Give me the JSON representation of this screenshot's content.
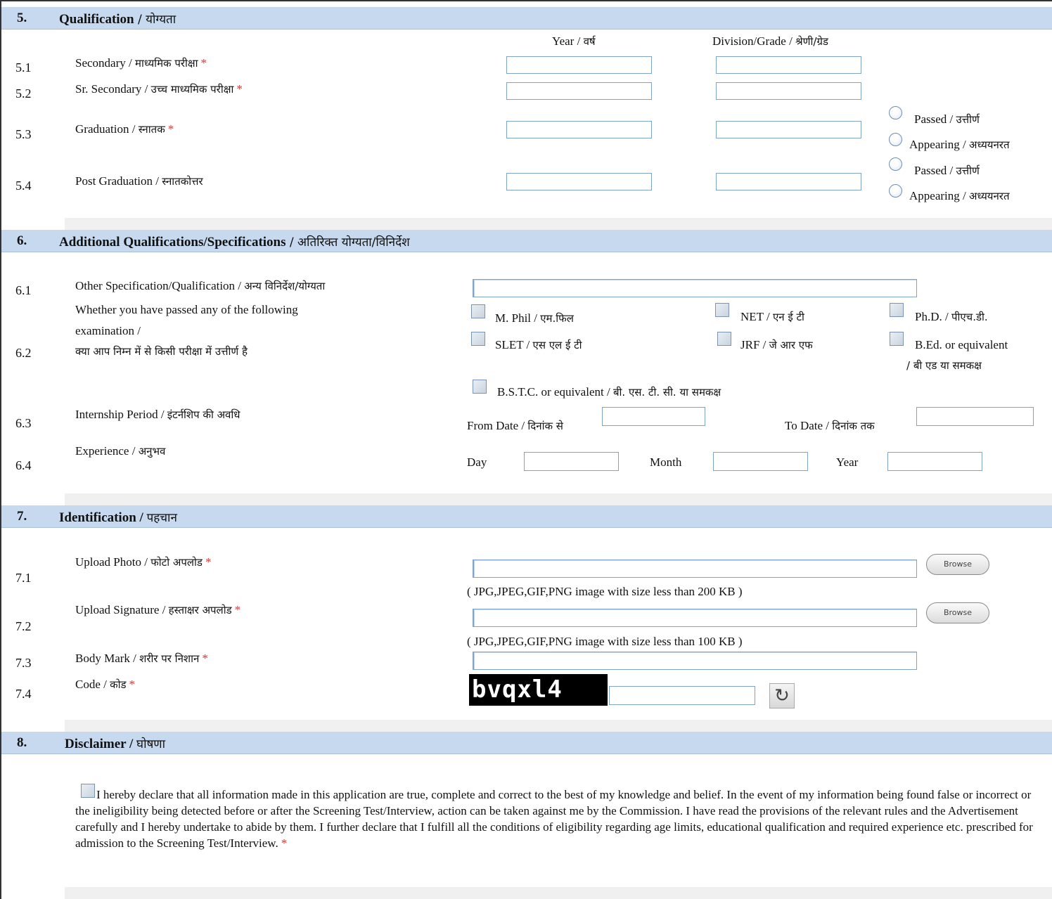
{
  "sec5": {
    "num": "5.",
    "title": "Qualification",
    "title_hi": " / योग्यता",
    "col_year": "Year / ",
    "col_year_hi": "वर्ष",
    "col_div": "Division/Grade / ",
    "col_div_hi": "श्रेणी/ग्रेड",
    "rows": [
      {
        "num": "5.1",
        "label": "Secondary / ",
        "label_hi": "माध्यमिक परीक्षा",
        "req": "*"
      },
      {
        "num": "5.2",
        "label": "Sr. Secondary / ",
        "label_hi": "उच्च माध्यमिक परीक्षा",
        "req": "*"
      },
      {
        "num": "5.3",
        "label": "Graduation  / ",
        "label_hi": "स्नातक",
        "req": "*"
      },
      {
        "num": "5.4",
        "label": "Post Graduation  / ",
        "label_hi": "स्नातकोत्तर",
        "req": ""
      }
    ],
    "passed": "Passed / ",
    "passed_hi": "उत्तीर्ण",
    "appearing": "Appearing / ",
    "appearing_hi": "अध्ययनरत"
  },
  "sec6": {
    "num": "6.",
    "title": "Additional Qualifications/Specifications",
    "title_hi": " / अतिरिक्त योग्यता/विनिर्देश",
    "r1": {
      "num": "6.1",
      "label": "Other Specification/Qualification / ",
      "label_hi": "अन्य विनिर्देश/योग्यता"
    },
    "r2": {
      "num": "6.2",
      "label1": "Whether you have passed any of the following",
      "label2": "examination  /",
      "label_hi": "क्या आप निम्न में से किसी परीक्षा में उत्तीर्ण है"
    },
    "exams": {
      "mphil": "M. Phil / ",
      "mphil_hi": "एम.फिल",
      "net": "NET / ",
      "net_hi": "एन ई टी",
      "phd": "Ph.D. / ",
      "phd_hi": "पीएच.डी.",
      "slet": "SLET / ",
      "slet_hi": "एस एल ई टी",
      "jrf": "JRF / ",
      "jrf_hi": "जे आर एफ",
      "bed": "B.Ed. or equivalent",
      "bed_hi": "/ बी एड या समकक्ष",
      "bstc": "B.S.T.C. or equivalent / ",
      "bstc_hi": "बी. एस. टी. सी. या समकक्ष"
    },
    "r3": {
      "num": "6.3",
      "label": "Internship Period / ",
      "label_hi": "इंटर्नशिप की अवधि",
      "from": "From Date / ",
      "from_hi": "दिनांक से",
      "to": "To Date  / ",
      "to_hi": "दिनांक तक"
    },
    "r4": {
      "num": "6.4",
      "label": "Experience / ",
      "label_hi": "अनुभव",
      "day": "Day",
      "month": "Month",
      "year": "Year"
    }
  },
  "sec7": {
    "num": "7.",
    "title": "Identification / ",
    "title_hi": "पहचान",
    "r1": {
      "num": "7.1",
      "label": "Upload Photo / ",
      "label_hi": "फोटो अपलोड",
      "req": "*",
      "hint": "( JPG,JPEG,GIF,PNG image with size less than 200 KB )"
    },
    "r2": {
      "num": "7.2",
      "label": "Upload Signature / ",
      "label_hi": "हस्ताक्षर अपलोड",
      "req": "*",
      "hint": "( JPG,JPEG,GIF,PNG image with size less than 100 KB )"
    },
    "r3": {
      "num": "7.3",
      "label": "Body Mark / ",
      "label_hi": "शरीर पर निशान",
      "req": "*"
    },
    "r4": {
      "num": "7.4",
      "label": "Code / ",
      "label_hi": "कोड",
      "req": "*",
      "captcha": "bvqxl4"
    },
    "browse": "Browse",
    "refresh_icon": "↻"
  },
  "sec8": {
    "num": "8.",
    "title": "Disclaimer / ",
    "title_hi": "घोषणा",
    "text": "I hereby declare that all information made in this application are true, complete and correct to the best of my knowledge and belief. In the event of my information being found false or incorrect or the ineligibility being detected before or after the Screening Test/Interview, action can be taken against me by the Commission. I have read the provisions of the relevant rules and the Advertisement carefully and I hereby undertake to abide by them. I further declare that I fulfill all the conditions of eligibility regarding age limits, educational qualification and required experience etc. prescribed for admission to the Screening Test/Interview.",
    "req": "*"
  }
}
